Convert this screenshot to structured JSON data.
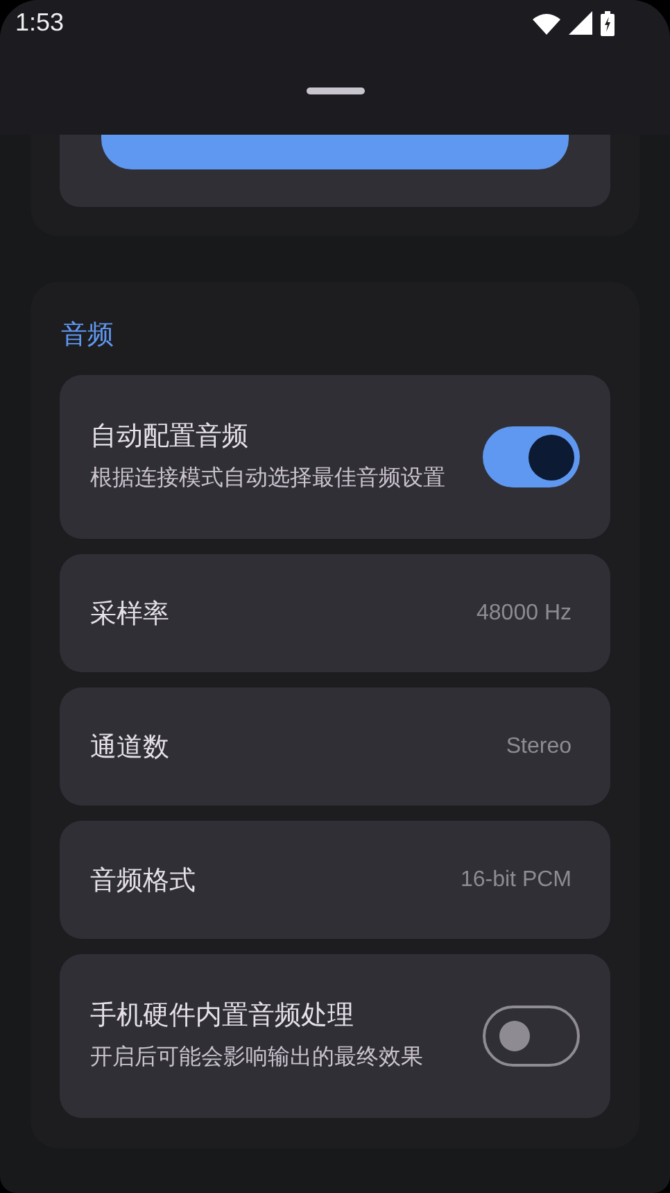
{
  "status_bar": {
    "time": "1:53"
  },
  "audio_section": {
    "title": "音频",
    "rows": [
      {
        "kind": "switch",
        "label": "自动配置音频",
        "description": "根据连接模式自动选择最佳音频设置",
        "checked": true
      },
      {
        "kind": "value",
        "label": "采样率",
        "value": "48000 Hz"
      },
      {
        "kind": "value",
        "label": "通道数",
        "value": "Stereo"
      },
      {
        "kind": "value",
        "label": "音频格式",
        "value": "16-bit PCM"
      },
      {
        "kind": "switch",
        "label": "手机硬件内置音频处理",
        "description": "开启后可能会影响输出的最终效果",
        "checked": false
      }
    ]
  }
}
